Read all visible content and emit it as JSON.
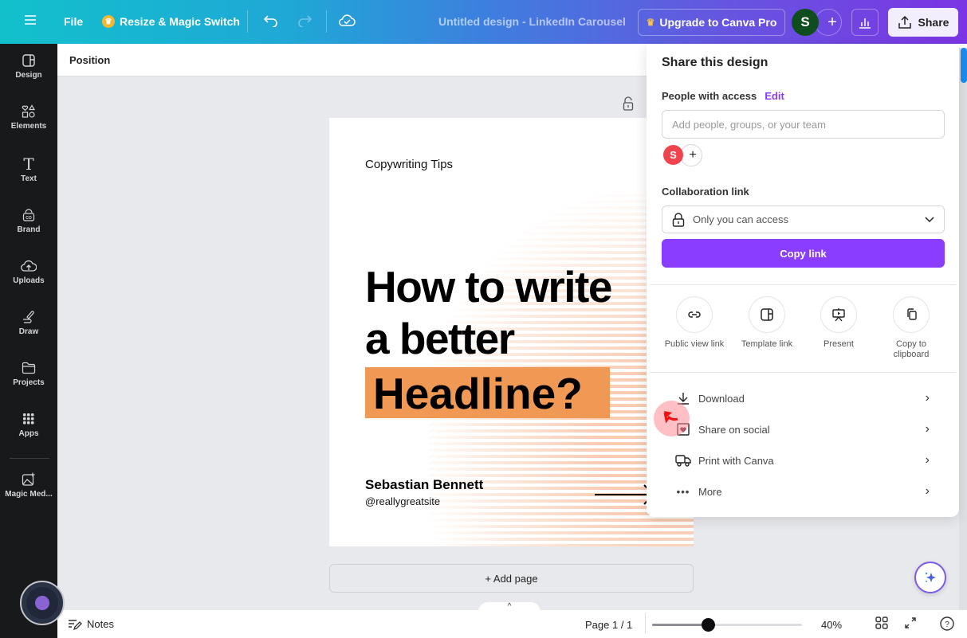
{
  "topbar": {
    "menu_icon": "hamburger-icon",
    "file_label": "File",
    "resize_label": "Resize & Magic Switch",
    "design_title": "Untitled design - LinkedIn Carousel",
    "upgrade_label": "Upgrade to Canva Pro",
    "avatar_initial": "S",
    "share_label": "Share"
  },
  "sidebar": {
    "items": [
      {
        "label": "Design",
        "icon": "layout-icon"
      },
      {
        "label": "Elements",
        "icon": "shapes-icon"
      },
      {
        "label": "Text",
        "icon": "text-icon"
      },
      {
        "label": "Brand",
        "icon": "brand-icon"
      },
      {
        "label": "Uploads",
        "icon": "cloud-upload-icon"
      },
      {
        "label": "Draw",
        "icon": "draw-icon"
      },
      {
        "label": "Projects",
        "icon": "folder-icon"
      },
      {
        "label": "Apps",
        "icon": "apps-grid-icon"
      },
      {
        "label": "Magic Med...",
        "icon": "magic-media-icon"
      }
    ]
  },
  "context_bar": {
    "position_label": "Position"
  },
  "design_page": {
    "subtitle": "Copywriting Tips",
    "headline_line1": "How to write",
    "headline_line2": "a better",
    "headline_line3": "Headline?",
    "author_name": "Sebastian Bennett",
    "author_handle": "@reallygreatsite",
    "highlight_color": "#ef9955"
  },
  "canvas": {
    "add_page_label": "+ Add page"
  },
  "share_panel": {
    "title": "Share this design",
    "people_label": "People with access",
    "edit_label": "Edit",
    "add_people_placeholder": "Add people, groups, or your team",
    "member_initial": "S",
    "collab_label": "Collaboration link",
    "access_value": "Only you can access",
    "copy_link_label": "Copy link",
    "options": [
      {
        "label": "Public view link",
        "icon": "link-icon"
      },
      {
        "label": "Template link",
        "icon": "template-icon"
      },
      {
        "label": "Present",
        "icon": "present-icon"
      },
      {
        "label": "Copy to clipboard",
        "icon": "copy-icon"
      }
    ],
    "rows": [
      {
        "label": "Download",
        "icon": "download-icon"
      },
      {
        "label": "Share on social",
        "icon": "social-heart-icon"
      },
      {
        "label": "Print with Canva",
        "icon": "truck-icon"
      },
      {
        "label": "More",
        "icon": "more-dots-icon"
      }
    ],
    "accent_color": "#8b3dff"
  },
  "bottombar": {
    "notes_label": "Notes",
    "page_label": "Page 1 / 1",
    "zoom_label": "40%",
    "zoom_fraction": 0.37
  }
}
